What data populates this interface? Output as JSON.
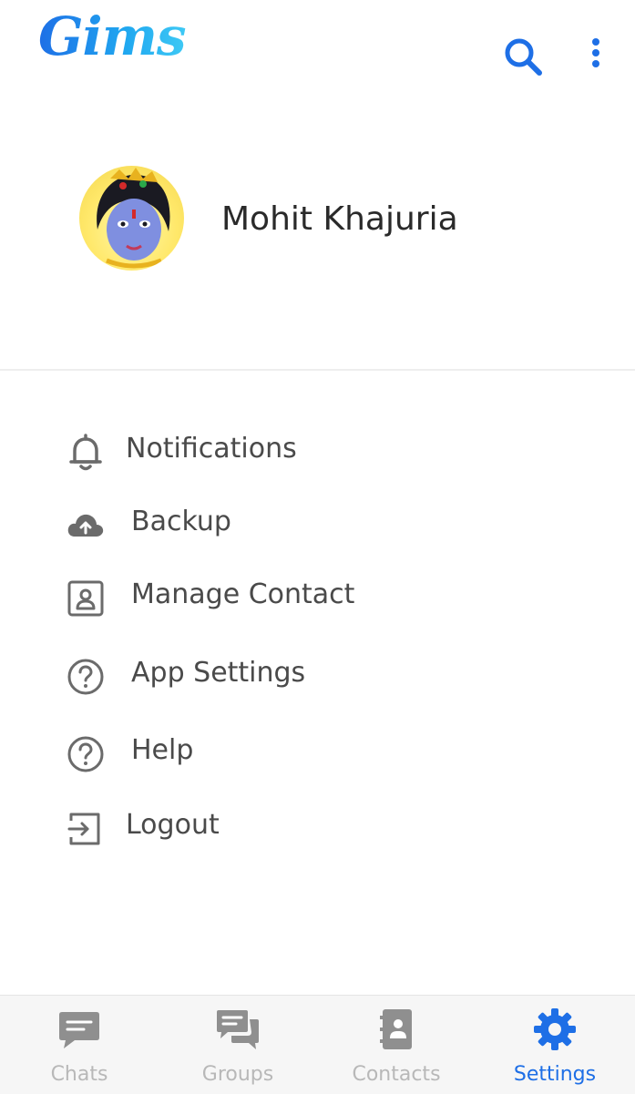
{
  "app": {
    "logo_text": "Gims"
  },
  "header": {
    "search_icon": "search-icon",
    "menu_icon": "more-vertical-icon"
  },
  "profile": {
    "name": "Mohit Khajuria",
    "avatar": "profile-avatar"
  },
  "menu": {
    "items": [
      {
        "label": "Notifications",
        "icon": "bell-icon"
      },
      {
        "label": "Backup",
        "icon": "cloud-upload-icon"
      },
      {
        "label": "Manage Contact",
        "icon": "contact-card-icon"
      },
      {
        "label": "App Settings",
        "icon": "help-circle-icon"
      },
      {
        "label": "Help",
        "icon": "help-circle-icon"
      },
      {
        "label": "Logout",
        "icon": "logout-icon"
      }
    ]
  },
  "bottom_nav": {
    "tabs": [
      {
        "label": "Chats",
        "icon": "chat-bubble-icon",
        "active": false
      },
      {
        "label": "Groups",
        "icon": "group-chat-icon",
        "active": false
      },
      {
        "label": "Contacts",
        "icon": "address-book-icon",
        "active": false
      },
      {
        "label": "Settings",
        "icon": "gear-icon",
        "active": true
      }
    ]
  },
  "colors": {
    "accent": "#1e6fe6",
    "icon_gray": "#6b6b6b",
    "inactive_tab": "#b8b8b8",
    "nav_background": "#f6f6f6"
  }
}
